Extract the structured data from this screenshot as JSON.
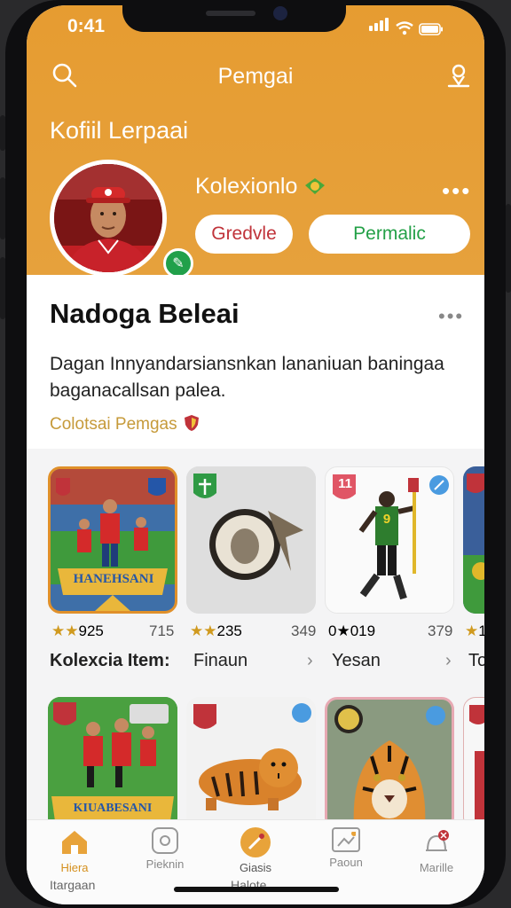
{
  "status": {
    "time": "0:41"
  },
  "nav": {
    "title": "Pemgai"
  },
  "profile": {
    "heading": "Kofiil Lerpaai",
    "collection_label": "Kolexionlo",
    "button_secondary": "Gredvle",
    "button_primary": "Permalic",
    "name": "Nadoga Beleai",
    "description": "Dagan Innyandarsiansnkan lananiuan baningaa baganacallsan palea.",
    "subtitle": "Colotsai Pemgas"
  },
  "items_row1": [
    {
      "title": "HANEHSANI",
      "rating": "★★925",
      "count": "715"
    },
    {
      "rating": "★★235",
      "count": "349"
    },
    {
      "badge": "11",
      "jersey": "9",
      "rating": "0★019",
      "count": "379"
    },
    {
      "rating": "★1"
    }
  ],
  "items_row2": [
    {
      "title": "KIUABESANI"
    },
    {},
    {},
    {}
  ],
  "row_labels": {
    "collection": "Kolexcia Item:",
    "col2": "Finaun",
    "col3": "Yesan",
    "col4": "To"
  },
  "tabs": [
    {
      "label": "Hiera"
    },
    {
      "label": "Pieknin"
    },
    {
      "label": "Giasis"
    },
    {
      "label": "Paoun"
    },
    {
      "label": "Marille"
    }
  ],
  "bottom": {
    "left": "Itargaan",
    "center": "Halote"
  },
  "colors": {
    "header": "#e69c31",
    "primary_green": "#23a047",
    "accent_red": "#c0333a"
  }
}
